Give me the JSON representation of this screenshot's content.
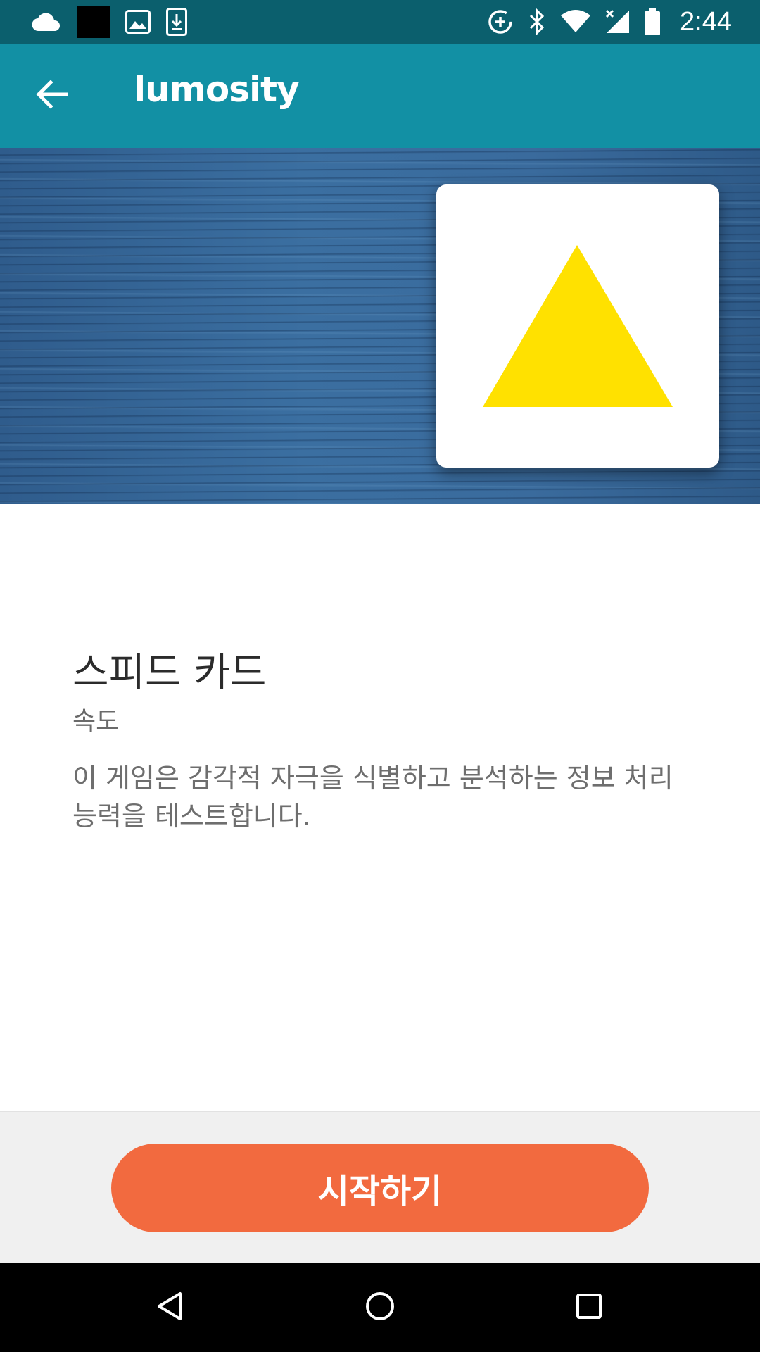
{
  "status_bar": {
    "time": "2:44",
    "left_icons": [
      "cloud-icon",
      "app-square-icon",
      "image-icon",
      "download-icon"
    ],
    "right_icons": [
      "data-saver-icon",
      "bluetooth-icon",
      "wifi-icon",
      "cellular-icon",
      "battery-icon"
    ]
  },
  "app_bar": {
    "title": "lumosity",
    "back_icon": "arrow-left-icon",
    "color": "#1290a4"
  },
  "hero": {
    "card_icon": "yellow-triangle-icon",
    "triangle_color": "#ffe100",
    "background_color": "#3b6fa1"
  },
  "game": {
    "title": "스피드 카드",
    "category": "속도",
    "description": "이 게임은 감각적 자극을 식별하고 분석하는 정보 처리 능력을 테스트합니다."
  },
  "footer": {
    "start_label": "시작하기",
    "button_color": "#f26a3f"
  },
  "nav_bar": {
    "icons": [
      "back-triangle-icon",
      "home-circle-icon",
      "recents-square-icon"
    ]
  }
}
